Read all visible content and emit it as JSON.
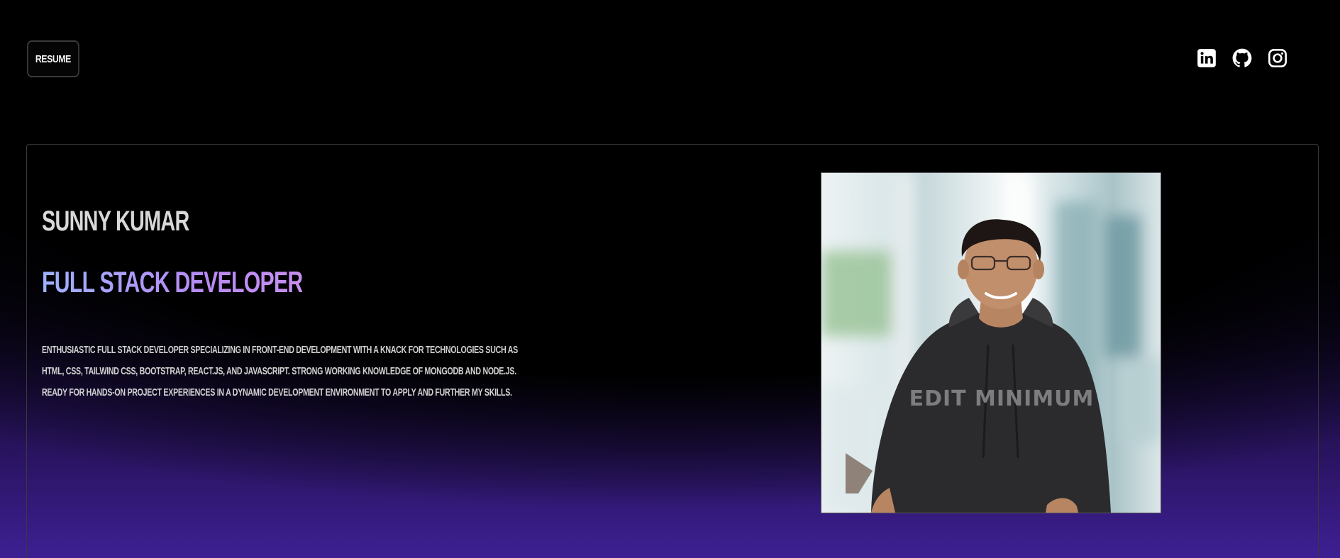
{
  "header": {
    "resume_label": "RESUME",
    "socials": [
      {
        "name": "LinkedIn",
        "icon": "linkedin-icon"
      },
      {
        "name": "GitHub",
        "icon": "github-icon"
      },
      {
        "name": "Instagram",
        "icon": "instagram-icon"
      }
    ]
  },
  "hero": {
    "name": "SUNNY KUMAR",
    "role": "FULL STACK DEVELOPER",
    "bio_lines": [
      "ENTHUSIASTIC FULL STACK DEVELOPER SPECIALIZING IN FRONT-END DEVELOPMENT WITH A KNACK FOR TECHNOLOGIES SUCH AS",
      "HTML, CSS, TAILWIND CSS, BOOTSTRAP, REACT.JS, AND JAVASCRIPT. STRONG WORKING KNOWLEDGE OF MONGODB AND NODE.JS.",
      "READY FOR HANDS-ON PROJECT EXPERIENCES IN A DYNAMIC DEVELOPMENT ENVIRONMENT TO APPLY AND FURTHER MY SKILLS."
    ],
    "hoodie_text": "EDIT MINIMUM"
  },
  "colors": {
    "background_top": "#000000",
    "background_bottom": "#3d2093",
    "role_gradient_start": "#9db2ff",
    "role_gradient_end": "#c78ff0",
    "text": "#d8d8d8"
  }
}
